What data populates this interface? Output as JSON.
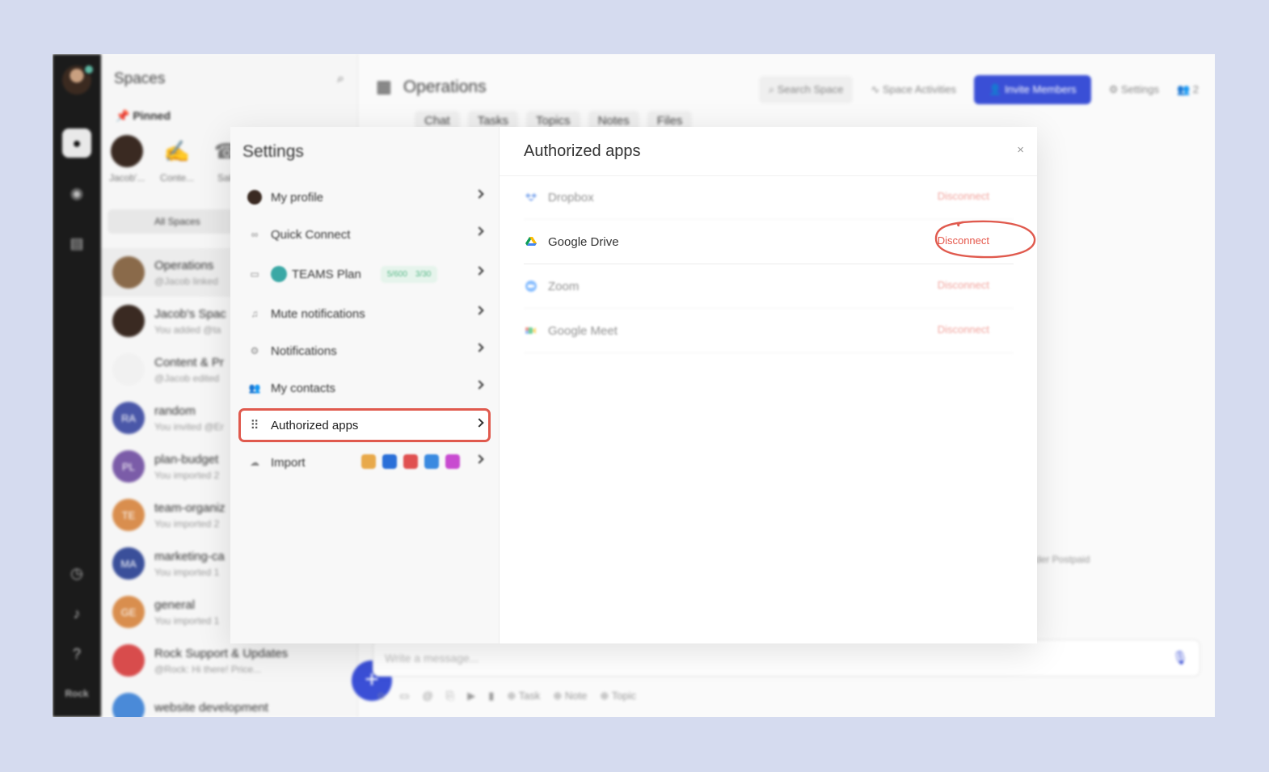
{
  "colors": {
    "accent": "#3a4fd6",
    "highlight": "#e05a4e",
    "disconnect": "#e5574b",
    "background": "#d5dbef"
  },
  "rail": {
    "icons": [
      "avatar",
      "chat-icon",
      "circle-icon",
      "document-icon",
      "clock-icon",
      "bell-icon",
      "help-icon"
    ],
    "logo": "Rock"
  },
  "spaces": {
    "title": "Spaces",
    "pinned_label": "Pinned",
    "pinned": [
      {
        "label": "Jacob'..."
      },
      {
        "label": "Conte..."
      },
      {
        "label": "Sale"
      }
    ],
    "all_spaces": "All Spaces",
    "items": [
      {
        "initials": "",
        "name": "Operations",
        "sub": "@Jacob linked",
        "color": "#8a6a4a"
      },
      {
        "initials": "",
        "name": "Jacob's Spac",
        "sub": "You added @ta",
        "color": "#3a2a22"
      },
      {
        "initials": "",
        "name": "Content & Pr",
        "sub": "@Jacob edited",
        "color": "#f1f1f1"
      },
      {
        "initials": "RA",
        "name": "random",
        "sub": "You invited @Er",
        "color": "#4a57a8"
      },
      {
        "initials": "PL",
        "name": "plan-budget",
        "sub": "You imported 2",
        "color": "#7b5ca8"
      },
      {
        "initials": "TE",
        "name": "team-organiz",
        "sub": "You imported 2",
        "color": "#d98e4e"
      },
      {
        "initials": "MA",
        "name": "marketing-ca",
        "sub": "You imported 1",
        "color": "#3a4f9a"
      },
      {
        "initials": "GE",
        "name": "general",
        "sub": "You imported 1",
        "color": "#d98e4e"
      },
      {
        "initials": "",
        "name": "Rock Support & Updates",
        "sub": "@Rock: Hi there! Price...",
        "color": "#d84c4c"
      },
      {
        "initials": "",
        "name": "website development",
        "sub": "",
        "color": "#4a8ad8"
      }
    ]
  },
  "main": {
    "title": "Operations",
    "search_label": "Search Space",
    "activities_label": "Space Activities",
    "invite_label": "Invite Members",
    "settings_label": "Settings",
    "members_count": "2",
    "tabs": [
      "Chat",
      "Tasks",
      "Topics",
      "Notes",
      "Files"
    ],
    "composer_placeholder": "Write a message...",
    "tools": [
      "Task",
      "Note",
      "Topic"
    ],
    "bg_note": "der Postpaid"
  },
  "settings": {
    "title": "Settings",
    "nav": [
      {
        "label": "My profile",
        "icon": "profile-avatar-icon"
      },
      {
        "label": "Quick Connect",
        "icon": "link-icon"
      },
      {
        "label": "TEAMS Plan",
        "icon": "calendar-icon",
        "badge_a": "5/600",
        "badge_b": "3/30"
      },
      {
        "label": "Mute notifications",
        "icon": "bell-icon"
      },
      {
        "label": "Notifications",
        "icon": "gear-icon"
      },
      {
        "label": "My contacts",
        "icon": "contacts-icon"
      },
      {
        "label": "Authorized apps",
        "icon": "grid-icon",
        "active": true
      },
      {
        "label": "Import",
        "icon": "cloud-icon"
      }
    ],
    "content": {
      "title": "Authorized apps",
      "close": "×",
      "apps": [
        {
          "name": "Dropbox",
          "action": "Disconnect",
          "highlighted": false
        },
        {
          "name": "Google Drive",
          "action": "Disconnect",
          "highlighted": true
        },
        {
          "name": "Zoom",
          "action": "Disconnect",
          "highlighted": false
        },
        {
          "name": "Google Meet",
          "action": "Disconnect",
          "highlighted": false
        }
      ]
    }
  }
}
